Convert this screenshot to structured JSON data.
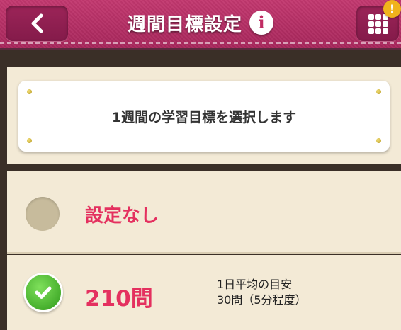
{
  "header": {
    "title": "週間目標設定",
    "info_glyph": "i",
    "badge_glyph": "!"
  },
  "intro": {
    "text": "1週間の学習目標を選択します"
  },
  "options": [
    {
      "label": "設定なし",
      "selected": false
    },
    {
      "label": "210問",
      "selected": true,
      "note_line1": "1日平均の目安",
      "note_line2": "30問（5分程度）"
    }
  ],
  "colors": {
    "header": "#b3306a",
    "accent_text": "#e4305f",
    "panel": "#f3ead6",
    "check": "#3fb82a",
    "badge": "#f0b31c"
  },
  "icons": {
    "back": "chevron-left-icon",
    "info": "info-icon",
    "menu": "grid-menu-icon",
    "badge": "alert-badge-icon",
    "check": "check-icon"
  }
}
